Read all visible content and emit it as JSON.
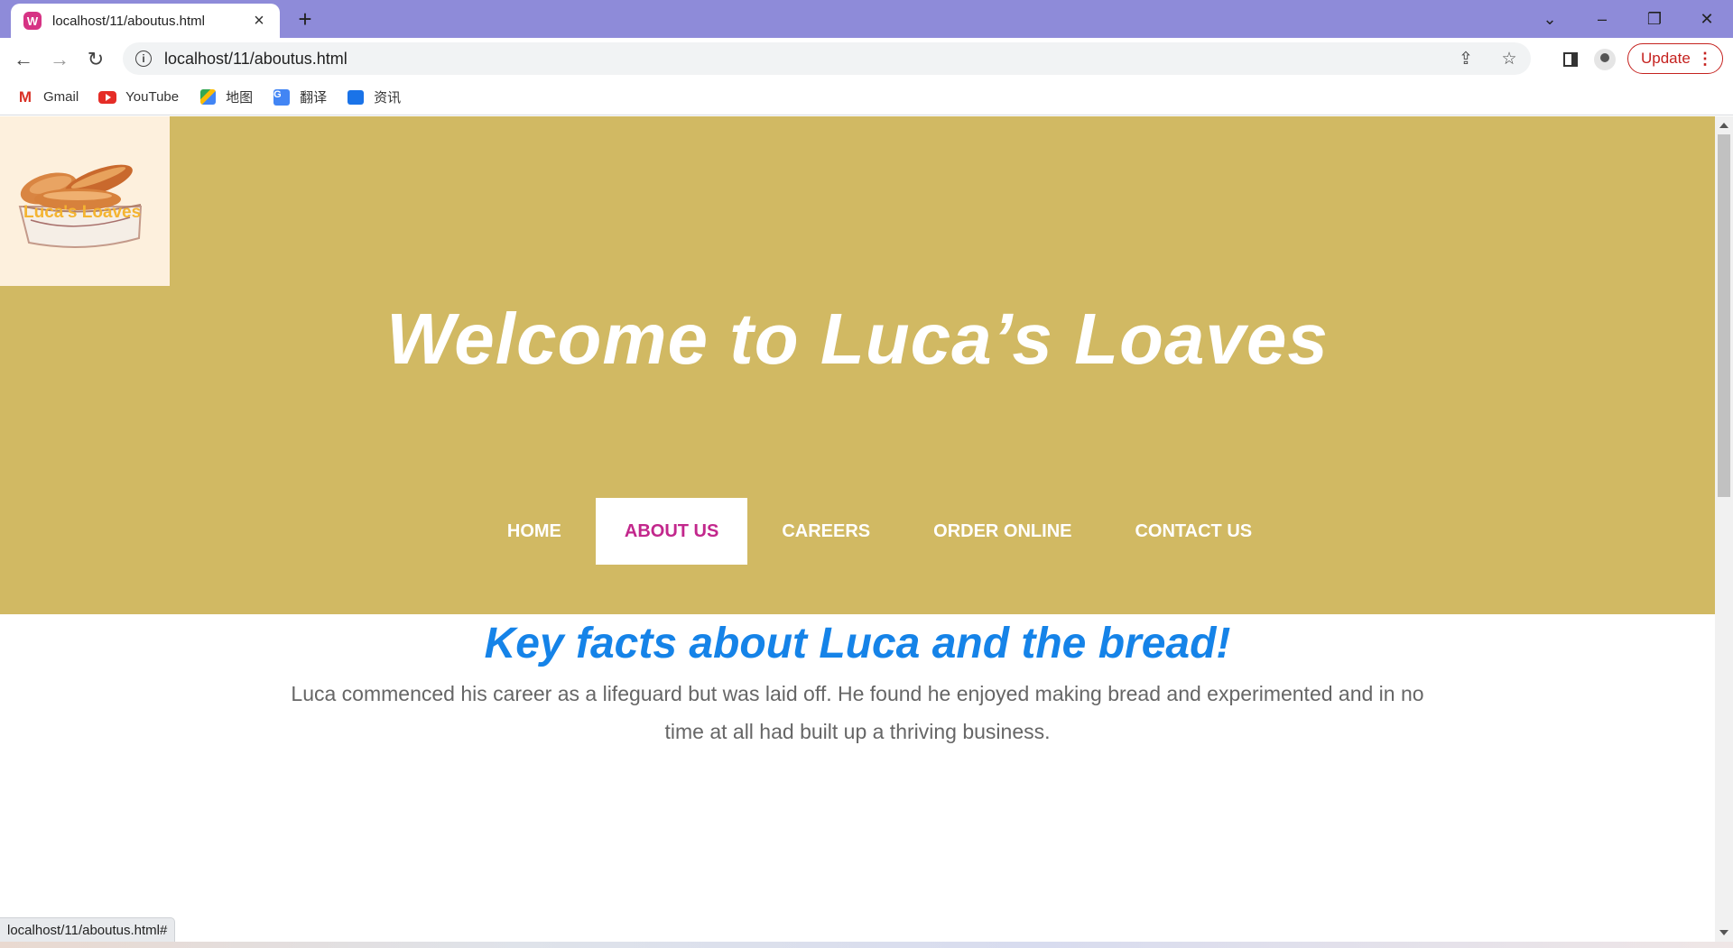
{
  "browser": {
    "tab": {
      "title": "localhost/11/aboutus.html",
      "favicon": "W"
    },
    "new_tab": "+",
    "window_controls": {
      "tabsearch": "⌄",
      "minimize": "–",
      "restore": "❐",
      "close": "✕"
    },
    "address_bar": {
      "url": "localhost/11/aboutus.html"
    },
    "update_label": "Update",
    "bookmarks": [
      {
        "label": "Gmail",
        "icon": "gmail-icon"
      },
      {
        "label": "YouTube",
        "icon": "youtube-icon"
      },
      {
        "label": "地图",
        "icon": "maps-icon"
      },
      {
        "label": "翻译",
        "icon": "translate-icon"
      },
      {
        "label": "资讯",
        "icon": "news-icon"
      }
    ],
    "status_url": "localhost/11/aboutus.html#"
  },
  "page": {
    "logo_text": "Luca's Loaves",
    "hero_title": "Welcome to Luca’s Loaves",
    "nav": [
      {
        "label": "HOME",
        "active": false
      },
      {
        "label": "ABOUT US",
        "active": true
      },
      {
        "label": "CAREERS",
        "active": false
      },
      {
        "label": "ORDER ONLINE",
        "active": false
      },
      {
        "label": "CONTACT US",
        "active": false
      }
    ],
    "section": {
      "title": "Key facts about Luca and the bread!",
      "text": "Luca commenced his career as a lifeguard but was laid off. He found he enjoyed making bread and experimented and in no time at all had built up a thriving business."
    }
  },
  "colors": {
    "tabstrip": "#8e8bd9",
    "hero": "#d1b963",
    "nav_active_text": "#c2278c",
    "section_title": "#1583e8",
    "update_red": "#c5221f"
  }
}
